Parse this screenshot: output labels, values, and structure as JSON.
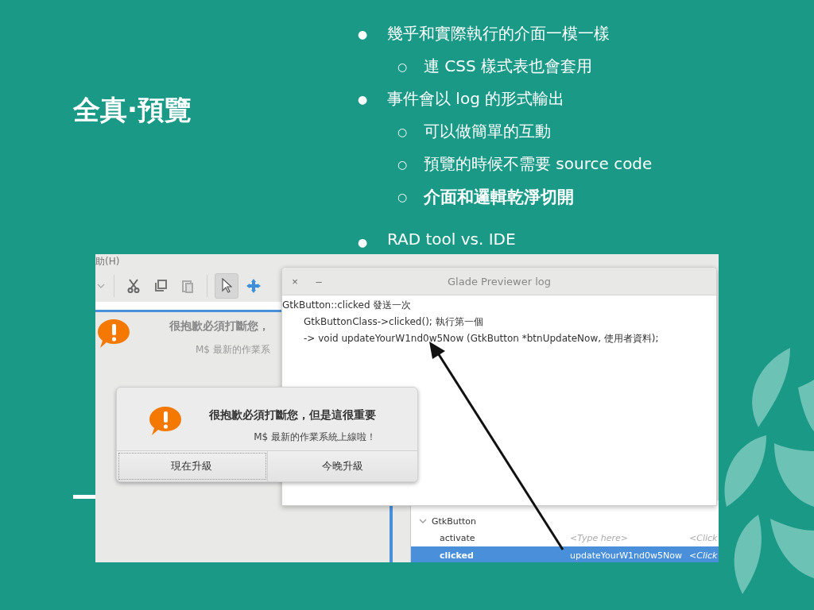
{
  "slide": {
    "title": "全真·預覽",
    "bullets": [
      {
        "marker": "●",
        "text": "幾乎和實際執行的介面一模一樣",
        "bold": false,
        "children": [
          {
            "marker": "○",
            "text": "連 CSS 樣式表也會套用",
            "bold": false
          }
        ]
      },
      {
        "marker": "●",
        "text": "事件會以 log 的形式輸出",
        "bold": false,
        "children": [
          {
            "marker": "○",
            "text": "可以做簡單的互動",
            "bold": false
          },
          {
            "marker": "○",
            "text": "預覽的時候不需要 source code",
            "bold": false
          },
          {
            "marker": "○",
            "text": "介面和邏輯乾淨切開",
            "bold": true
          }
        ]
      },
      {
        "marker": "●",
        "text": "RAD tool vs. IDE",
        "bold": false
      }
    ]
  },
  "screenshot": {
    "editor": {
      "menu": "助(H)",
      "tools": [
        {
          "kind": "caret",
          "selected": false
        },
        {
          "kind": "cut",
          "selected": false
        },
        {
          "kind": "copy",
          "selected": false
        },
        {
          "kind": "paste",
          "selected": false
        },
        {
          "kind": "pointer",
          "selected": true
        },
        {
          "kind": "move",
          "selected": false
        }
      ],
      "infobar": {
        "title": "很抱歉必須打斷您，",
        "message": "M$ 最新的作業系"
      },
      "signals": {
        "group": "GtkButton",
        "expanded": true,
        "rows": [
          {
            "name": "activate",
            "handler": "<Type here>",
            "handler_placeholder": true,
            "user_data": "<Click",
            "selected": false
          },
          {
            "name": "clicked",
            "handler": "updateYourW1nd0w5Now",
            "handler_placeholder": false,
            "user_data": "<Click",
            "selected": true
          }
        ]
      }
    },
    "log_window": {
      "title": "Glade Previewer log",
      "close": "×",
      "minimize": "–",
      "lines": [
        {
          "text": "GtkButton::clicked 發送一次",
          "children": [
            {
              "text": "GtkButtonClass->clicked(); 執行第一個"
            },
            {
              "text": "-> void updateYourW1nd0w5Now (GtkButton *btnUpdateNow, 使用者資料);"
            }
          ]
        }
      ]
    },
    "dialog": {
      "title": "很抱歉必須打斷您，但是這很重要",
      "message": "M$ 最新的作業系統上線啦！",
      "buttons": [
        {
          "label": "現在升級",
          "selected": true
        },
        {
          "label": "今晚升級",
          "selected": false
        }
      ]
    }
  }
}
